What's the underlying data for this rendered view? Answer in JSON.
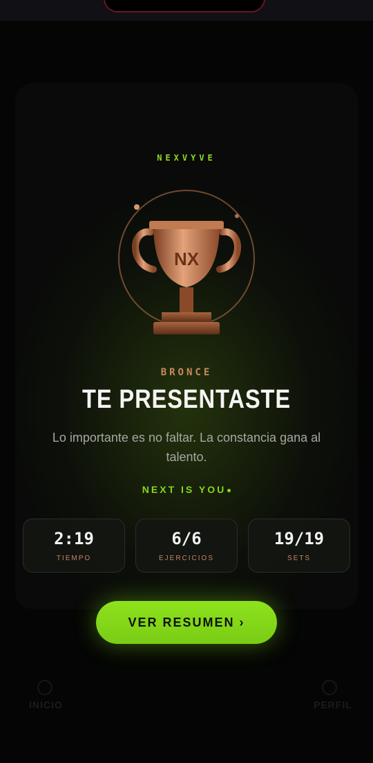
{
  "brand": "NEXVYVE",
  "trophy": {
    "emblem": "NX",
    "tier_color": "#c98a5e"
  },
  "tier": "BRONCE",
  "title": "TE PRESENTASTE",
  "subtitle": "Lo importante es no faltar. La constancia gana al talento.",
  "tagline": "NEXT IS YOU",
  "stats": [
    {
      "value": "2:19",
      "label": "TIEMPO"
    },
    {
      "value": "6/6",
      "label": "EJERCICIOS"
    },
    {
      "value": "19/19",
      "label": "SETS"
    }
  ],
  "cta_label": "VER RESUMEN ›",
  "background_nav": {
    "left": "INICIO",
    "right": "PERFIL"
  },
  "colors": {
    "accent": "#8ee21d",
    "bronze": "#c98a5e",
    "background": "#050605"
  }
}
